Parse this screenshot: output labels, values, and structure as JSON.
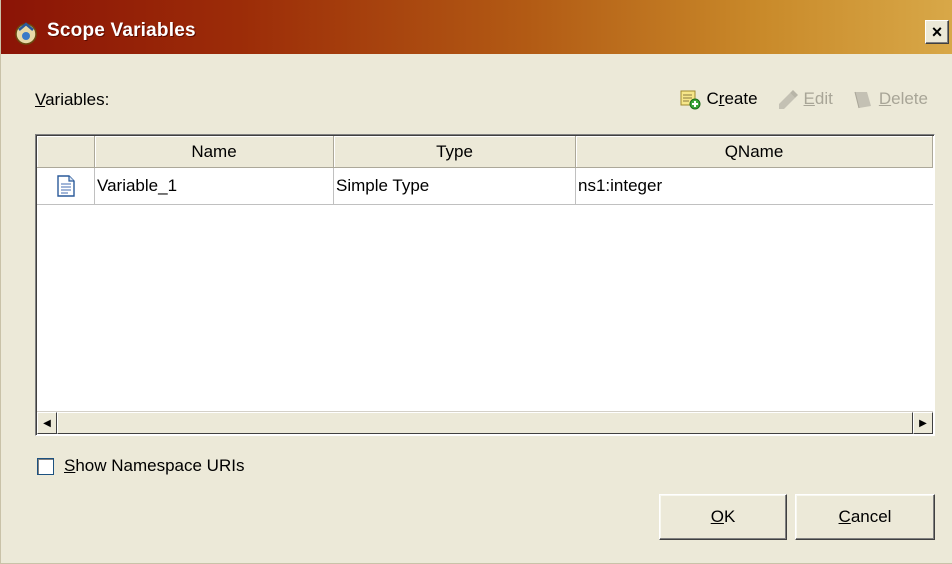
{
  "window": {
    "title": "Scope Variables",
    "close_glyph": "×"
  },
  "variables": {
    "label_accel": "V",
    "label_rest": "ariables:"
  },
  "toolbar": {
    "create": {
      "accel": "r",
      "pre": "C",
      "post": "eate",
      "icon": "create-icon",
      "enabled": true
    },
    "edit": {
      "accel": "E",
      "post": "dit",
      "icon": "edit-icon",
      "enabled": false
    },
    "delete": {
      "accel": "D",
      "post": "elete",
      "icon": "delete-icon",
      "enabled": false
    }
  },
  "table": {
    "columns": [
      "Name",
      "Type",
      "QName"
    ],
    "rows": [
      {
        "icon": "document-icon",
        "name": "Variable_1",
        "type": "Simple Type",
        "qname": "ns1:integer"
      }
    ]
  },
  "options": {
    "show_ns_accel": "S",
    "show_ns_rest": "how Namespace URIs",
    "show_ns_checked": false
  },
  "buttons": {
    "ok_accel": "O",
    "ok_rest": "K",
    "cancel_accel": "C",
    "cancel_rest": "ancel"
  },
  "colors": {
    "title_start": "#8b1406",
    "title_end": "#d8a848",
    "dialog_bg": "#ece9d8"
  }
}
